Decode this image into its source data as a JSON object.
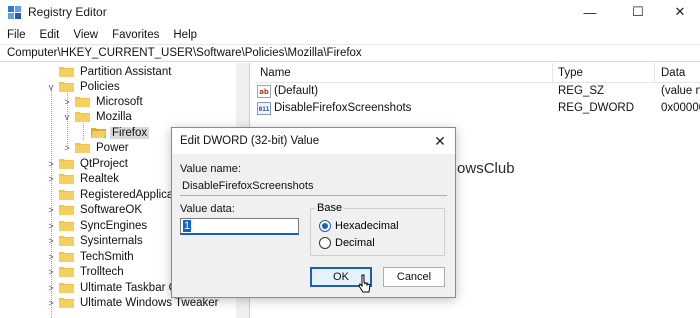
{
  "window": {
    "title": "Registry Editor",
    "icon": "registry-editor-icon",
    "controls": [
      "minimize-icon",
      "maximize-icon",
      "close-icon"
    ]
  },
  "menu": [
    "File",
    "Edit",
    "View",
    "Favorites",
    "Help"
  ],
  "address": "Computer\\HKEY_CURRENT_USER\\Software\\Policies\\Mozilla\\Firefox",
  "tree": {
    "items": [
      {
        "label": "Partition Assistant",
        "expander": ""
      },
      {
        "label": "Policies",
        "expander": "v"
      },
      {
        "label": "Microsoft",
        "expander": ">"
      },
      {
        "label": "Mozilla",
        "expander": "v"
      },
      {
        "label": "Firefox",
        "expander": ""
      },
      {
        "label": "Power",
        "expander": ">"
      },
      {
        "label": "QtProject",
        "expander": ">"
      },
      {
        "label": "Realtek",
        "expander": ">"
      },
      {
        "label": "RegisteredApplications",
        "expander": ""
      },
      {
        "label": "SoftwareOK",
        "expander": ">"
      },
      {
        "label": "SyncEngines",
        "expander": ">"
      },
      {
        "label": "Sysinternals",
        "expander": ">"
      },
      {
        "label": "TechSmith",
        "expander": ">"
      },
      {
        "label": "Trolltech",
        "expander": ">"
      },
      {
        "label": "Ultimate Taskbar Cor",
        "expander": ">"
      },
      {
        "label": "Ultimate Windows Tweaker",
        "expander": ">"
      }
    ],
    "selected": "Firefox"
  },
  "list": {
    "columns": [
      "Name",
      "Type",
      "Data"
    ],
    "rows": [
      {
        "name": "(Default)",
        "type": "REG_SZ",
        "data": "(value n",
        "icon": "string-value-icon"
      },
      {
        "name": "DisableFirefoxScreenshots",
        "type": "REG_DWORD",
        "data": "0x00000",
        "icon": "dword-value-icon"
      }
    ]
  },
  "watermark": {
    "text": "TheWindowsClub",
    "icon": "windowsclub-logo-icon"
  },
  "dialog": {
    "title": "Edit DWORD (32-bit) Value",
    "value_name_label": "Value name:",
    "value_name": "DisableFirefoxScreenshots",
    "value_data_label": "Value data:",
    "value_data": "1",
    "base_label": "Base",
    "base_options": [
      "Hexadecimal",
      "Decimal"
    ],
    "base_selected": "Hexadecimal",
    "ok_label": "OK",
    "cancel_label": "Cancel"
  },
  "colors": {
    "accent": "#1b5fb5",
    "selection": "#d9d9d9",
    "dialog_bg": "#f0f0f0"
  }
}
